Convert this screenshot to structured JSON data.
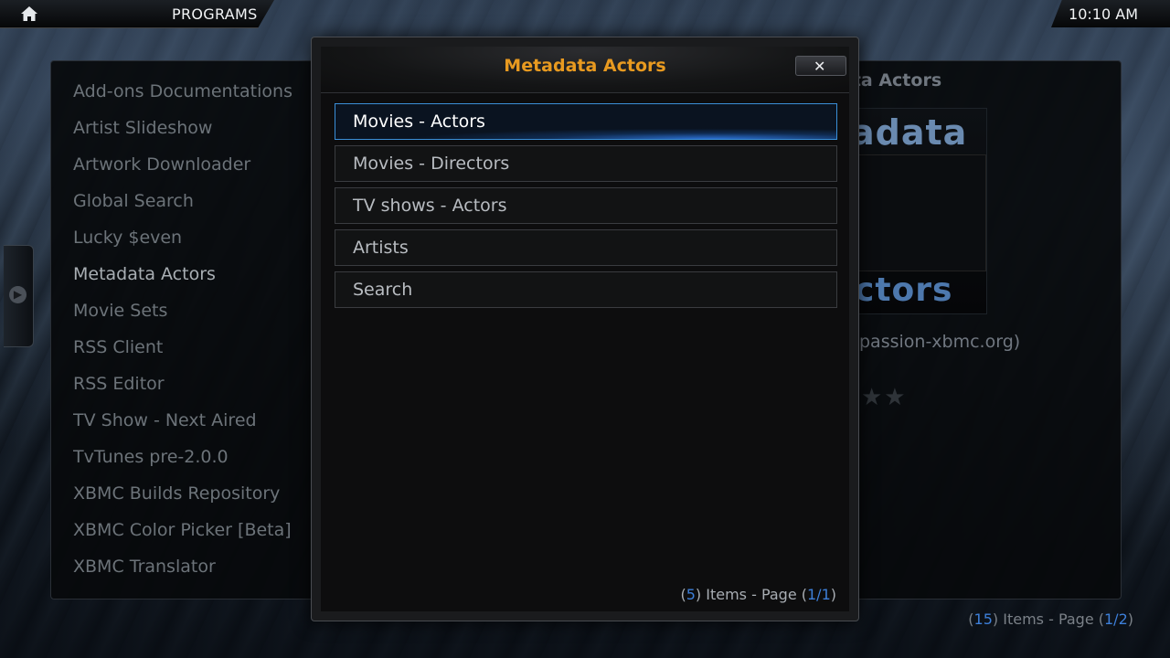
{
  "header": {
    "section": "PROGRAMS",
    "time": "10:10 AM",
    "home_icon": "home-icon"
  },
  "addons": {
    "items": [
      "Add-ons Documentations",
      "Artist Slideshow",
      "Artwork Downloader",
      "Global Search",
      "Lucky $even",
      "Metadata Actors",
      "Movie Sets",
      "RSS Client",
      "RSS Editor",
      "TV Show - Next Aired",
      "TvTunes pre-2.0.0",
      "XBMC Builds Repository",
      "XBMC Color Picker [Beta]",
      "XBMC Translator"
    ],
    "selected": "Metadata Actors"
  },
  "info": {
    "title": "ata Actors",
    "thumb_top": "adata",
    "thumb_bottom": "ctors",
    "author": "passion-xbmc.org)",
    "stars": "★★"
  },
  "footer": {
    "open": "(",
    "count": "15",
    "mid": ") Items - Page (",
    "page": "1/2",
    "close": ")"
  },
  "dialog": {
    "title": "Metadata Actors",
    "close_symbol": "✕",
    "options": [
      "Movies - Actors",
      "Movies - Directors",
      "TV shows - Actors",
      "Artists",
      "Search"
    ],
    "focused_index": 0,
    "count_open": "(",
    "count": "5",
    "count_mid": ") Items - Page (",
    "page": "1/1",
    "count_close": ")"
  },
  "colors": {
    "accent": "#3d7fd9",
    "title_orange": "#e89a20"
  }
}
